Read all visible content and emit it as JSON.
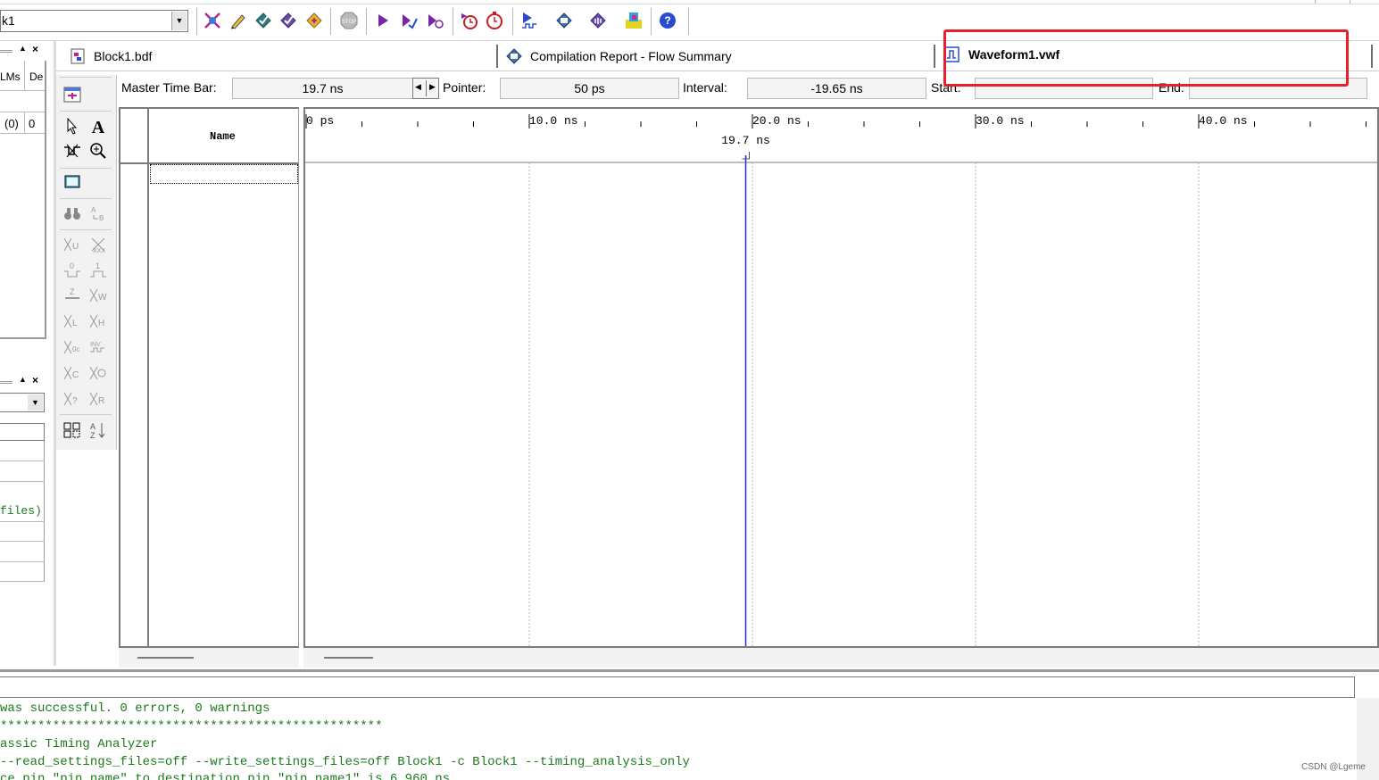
{
  "toolbar": {
    "project_value": "k1",
    "icons": [
      "analysis-icon",
      "edit-icon",
      "compile-check-icon",
      "compile-icon",
      "start-icon",
      "stop-icon",
      "run-icon",
      "run-to-icon",
      "step-icon",
      "timing-icon",
      "timer-icon",
      "simulate-icon",
      "waveform-icon",
      "programmer-icon",
      "chip-icon",
      "help-icon"
    ]
  },
  "left_panel": {
    "table1_headers": [
      "LMs",
      "De"
    ],
    "table1_row": [
      "(0)",
      "0"
    ],
    "table2_files_text": "files)"
  },
  "tabs": [
    {
      "label": "Block1.bdf",
      "icon": "block-diagram-icon"
    },
    {
      "label": "Compilation Report - Flow Summary",
      "icon": "report-icon"
    },
    {
      "label": "Waveform1.vwf",
      "icon": "waveform-file-icon",
      "active": true
    }
  ],
  "timebar": {
    "master_label": "Master Time Bar:",
    "master_value": "19.7 ns",
    "pointer_label": "Pointer:",
    "pointer_value": "50 ps",
    "interval_label": "Interval:",
    "interval_value": "-19.65 ns",
    "start_label": "Start:",
    "start_value": "",
    "end_label": "End:",
    "end_value": ""
  },
  "waveform": {
    "name_header": "Name",
    "ticks": [
      "0 ps",
      "10.0 ns",
      "20.0 ns",
      "30.0 ns",
      "40.0 ns"
    ],
    "master_time_marker_label": "19.7 ns",
    "time_range_ns": [
      0,
      48
    ],
    "master_time_ns": 19.7,
    "grid_ns": [
      10,
      20,
      30,
      40
    ]
  },
  "messages": [
    "was successful. 0 errors, 0 warnings",
    "***************************************************",
    "assic Timing Analyzer",
    "--read_settings_files=off --write_settings_files=off Block1 -c Block1 --timing_analysis_only",
    "ce pin \"pin_name\" to destination pin \"pin_name1\" is 6.960 ns"
  ],
  "watermark": "CSDN @Lgeme",
  "colors": {
    "highlight": "#e5212b",
    "marker": "#2c2cc8",
    "message_text": "#1a7a1a"
  }
}
